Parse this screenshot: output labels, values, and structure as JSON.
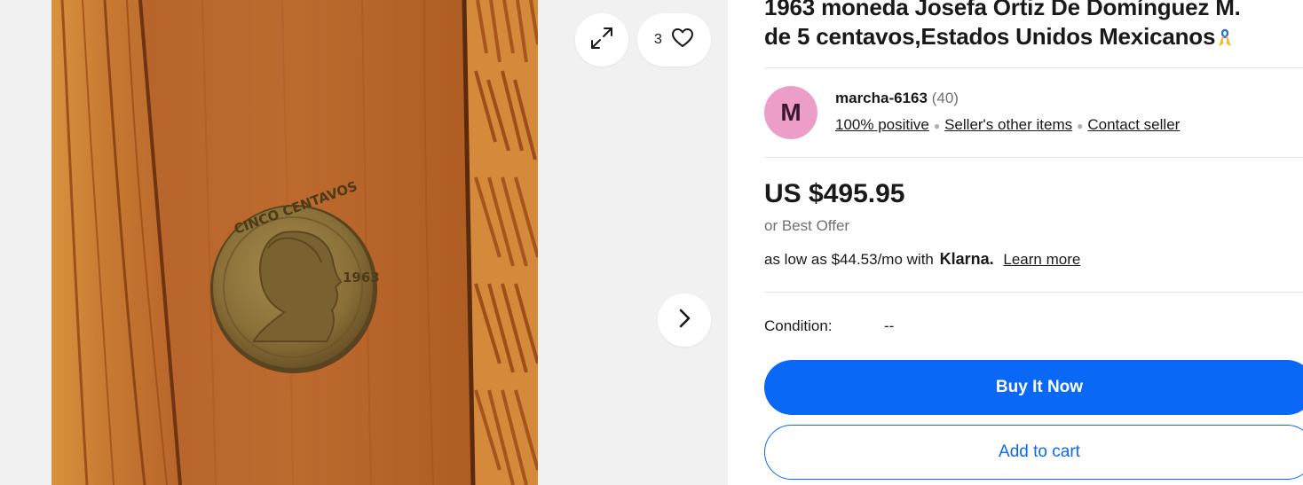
{
  "gallery": {
    "photo_alt": "1963 Mexican 5 centavos coin on wooden surface",
    "coin_legend": "CINCO CENTAVOS",
    "coin_year": "1963",
    "watch_count": "3",
    "icons": {
      "expand": "expand-icon",
      "heart": "heart-icon",
      "next": "chevron-right-icon"
    }
  },
  "listing": {
    "title_line1": "1963 moneda Josefa Ortiz De Domínguez M.",
    "title_line2": "de 5 centavos,Estados Unidos Mexicanos",
    "ribbon_icon": "ribbon-icon"
  },
  "seller": {
    "avatar_initial": "M",
    "avatar_color": "#ec9ec9",
    "name": "marcha-6163",
    "feedback_count": "(40)",
    "positive": "100% positive",
    "other_items": "Seller's other items",
    "contact": "Contact seller"
  },
  "pricing": {
    "price": "US $495.95",
    "best_offer": "or Best Offer",
    "klarna_prefix": "as low as $44.53/mo with",
    "klarna_logo": "Klarna.",
    "learn_more": "Learn more"
  },
  "condition": {
    "label": "Condition:",
    "value": "--"
  },
  "actions": {
    "buy_now": "Buy It Now",
    "add_to_cart": "Add to cart",
    "accent": "#0968f6"
  }
}
